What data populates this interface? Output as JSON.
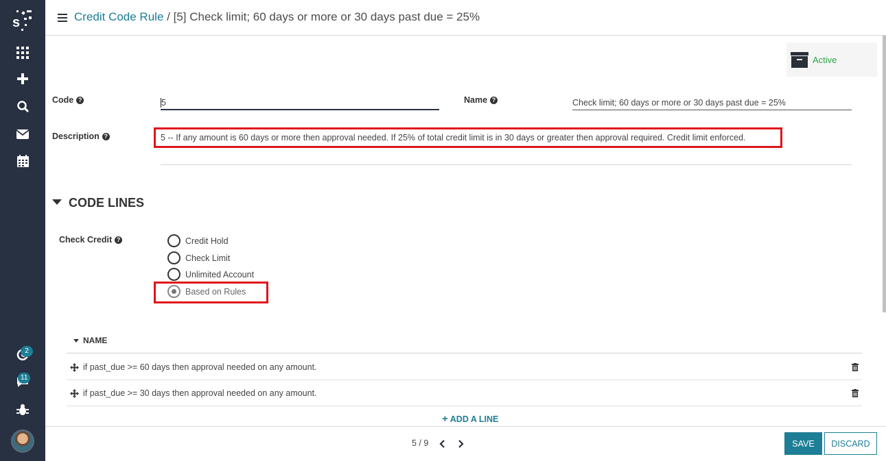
{
  "sidebar": {
    "icons": [
      "logo-icon",
      "apps-grid-icon",
      "plus-icon",
      "search-icon",
      "mail-icon",
      "calendar-icon",
      "activity-icon",
      "chat-icon",
      "bug-icon"
    ],
    "activity_badge": "2",
    "chat_badge": "11"
  },
  "header": {
    "breadcrumb_parent": "Credit Code Rule",
    "breadcrumb_sep": "/",
    "breadcrumb_current": "[5] Check limit; 60 days or more or 30 days past due = 25%"
  },
  "status": {
    "label": "Active"
  },
  "form": {
    "code_label": "Code",
    "code_value": "5",
    "name_label": "Name",
    "name_value": "Check limit; 60 days or more or 30 days past due = 25%",
    "description_label": "Description",
    "description_value": "5 -- If any amount is 60 days or more then approval needed. If 25% of total credit limit is in 30 days or greater then approval required. Credit limit enforced.",
    "help_glyph": "?"
  },
  "code_lines": {
    "title": "CODE LINES",
    "check_credit_label": "Check Credit",
    "options": [
      "Credit Hold",
      "Check Limit",
      "Unlimited Account",
      "Based on Rules"
    ],
    "selected": "Based on Rules",
    "table_header": "NAME",
    "rows": [
      "if past_due >= 60 days then approval needed on any amount.",
      "if past_due >= 30 days then approval needed on any amount."
    ],
    "add_line": "ADD A LINE",
    "add_line_icon": "+"
  },
  "footer": {
    "pager": "5 / 9",
    "save_label": "SAVE",
    "discard_label": "DISCARD"
  },
  "colors": {
    "accent": "#1d7e96",
    "sidebar": "#283142",
    "highlight": "#e0141b",
    "active": "#28a745"
  }
}
